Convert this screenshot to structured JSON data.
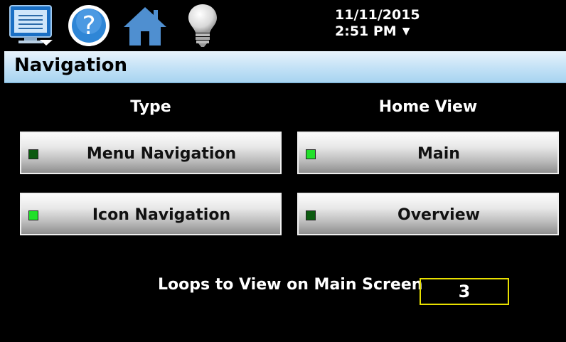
{
  "toolbar": {
    "icons": [
      "monitor-menu-icon",
      "help-icon",
      "home-icon",
      "lightbulb-icon"
    ],
    "date": "11/11/2015",
    "time": "2:51 PM",
    "caret": "▼"
  },
  "page": {
    "title": "Navigation"
  },
  "type_column": {
    "heading": "Type",
    "options": [
      {
        "label": "Menu Navigation",
        "selected": false
      },
      {
        "label": "Icon Navigation",
        "selected": true
      }
    ]
  },
  "home_view_column": {
    "heading": "Home View",
    "options": [
      {
        "label": "Main",
        "selected": true
      },
      {
        "label": "Overview",
        "selected": false
      }
    ]
  },
  "loops": {
    "label": "Loops to View on Main Screen",
    "value": "3"
  },
  "colors": {
    "led_on": "#22e02a",
    "led_off": "#0c5a10",
    "input_border": "#e8e000",
    "title_bar": "#b8dcf4"
  }
}
